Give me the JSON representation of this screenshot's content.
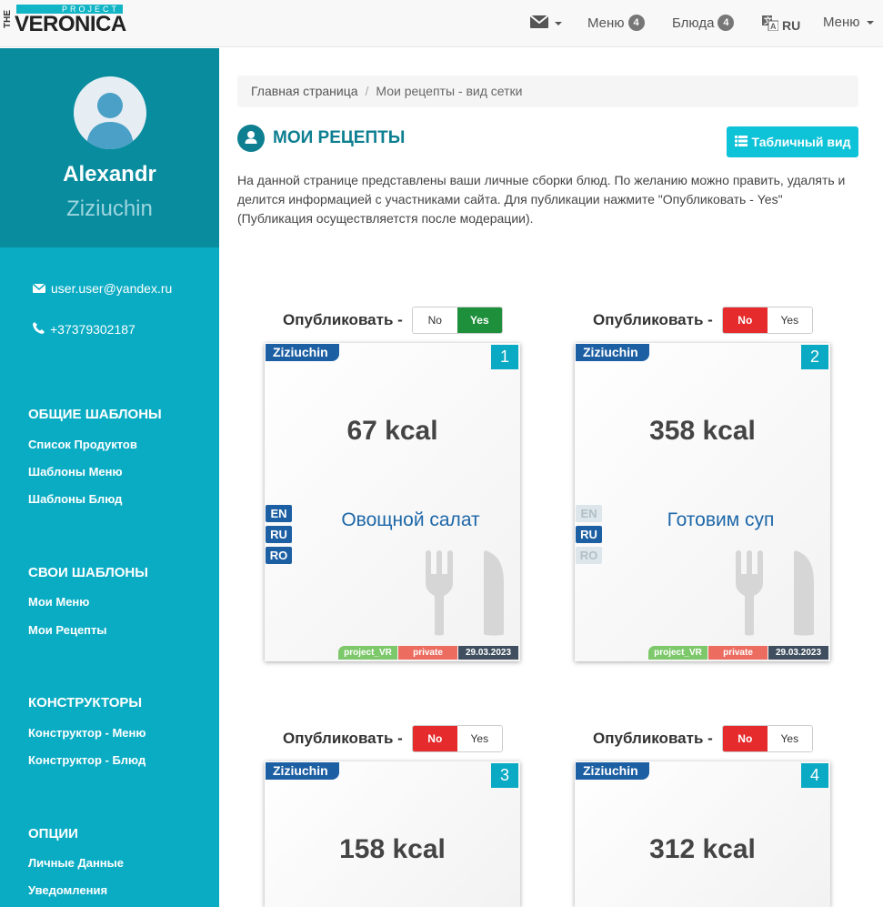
{
  "navbar": {
    "logo": {
      "the": "THE",
      "project": "PROJECT",
      "name": "VERONICA"
    },
    "mail_icon": "envelope-icon",
    "menu_label": "Меню",
    "menu_count": "4",
    "dishes_label": "Блюда",
    "dishes_count": "4",
    "lang_icon": "translate-icon",
    "lang_label": "RU",
    "user_menu_label": "Меню"
  },
  "sidebar": {
    "first_name": "Alexandr",
    "last_name": "Ziziuchin",
    "email": "user.user@yandex.ru",
    "phone": "+37379302187",
    "sections": [
      {
        "title": "ОБЩИЕ ШАБЛОНЫ",
        "links": [
          "Список Продуктов",
          "Шаблоны Меню",
          "Шаблоны Блюд"
        ]
      },
      {
        "title": "СВОИ ШАБЛОНЫ",
        "links": [
          "Мои Меню",
          "Мои Рецепты"
        ]
      },
      {
        "title": "КОНСТРУКТОРЫ",
        "links": [
          "Конструктор - Меню",
          "Конструктор - Блюд"
        ]
      },
      {
        "title": "ОПЦИИ",
        "links": [
          "Личные Данные",
          "Уведомления"
        ]
      }
    ]
  },
  "breadcrumb": {
    "home": "Главная страница",
    "separator": "/",
    "current": "Мои рецепты - вид сетки"
  },
  "page": {
    "title": "МОИ РЕЦЕПТЫ",
    "table_view_button": "Табличный вид",
    "description": "На данной странице представлены ваши личные сборки блюд. По желанию можно править, удалять и делится информацией с участниками сайта. Для публикации нажмите \"Опубликовать - Yes\" (Публикация осуществляетстя после модерации)."
  },
  "publish_label": "Опубликовать -",
  "toggle": {
    "no": "No",
    "yes": "Yes"
  },
  "recipes": [
    {
      "owner": "Ziziuchin",
      "number": "1",
      "kcal": "67 kcal",
      "name": "Овощной салат",
      "published": "Yes",
      "langs": [
        {
          "code": "EN",
          "active": true
        },
        {
          "code": "RU",
          "active": true
        },
        {
          "code": "RO",
          "active": true
        }
      ],
      "tags": {
        "project": "project_VR",
        "privacy": "private",
        "date": "29.03.2023"
      }
    },
    {
      "owner": "Ziziuchin",
      "number": "2",
      "kcal": "358 kcal",
      "name": "Готовим суп",
      "published": "No",
      "langs": [
        {
          "code": "EN",
          "active": false
        },
        {
          "code": "RU",
          "active": true
        },
        {
          "code": "RO",
          "active": false
        }
      ],
      "tags": {
        "project": "project_VR",
        "privacy": "private",
        "date": "29.03.2023"
      }
    },
    {
      "owner": "Ziziuchin",
      "number": "3",
      "kcal": "158 kcal",
      "published": "No"
    },
    {
      "owner": "Ziziuchin",
      "number": "4",
      "kcal": "312 kcal",
      "published": "No"
    }
  ]
}
